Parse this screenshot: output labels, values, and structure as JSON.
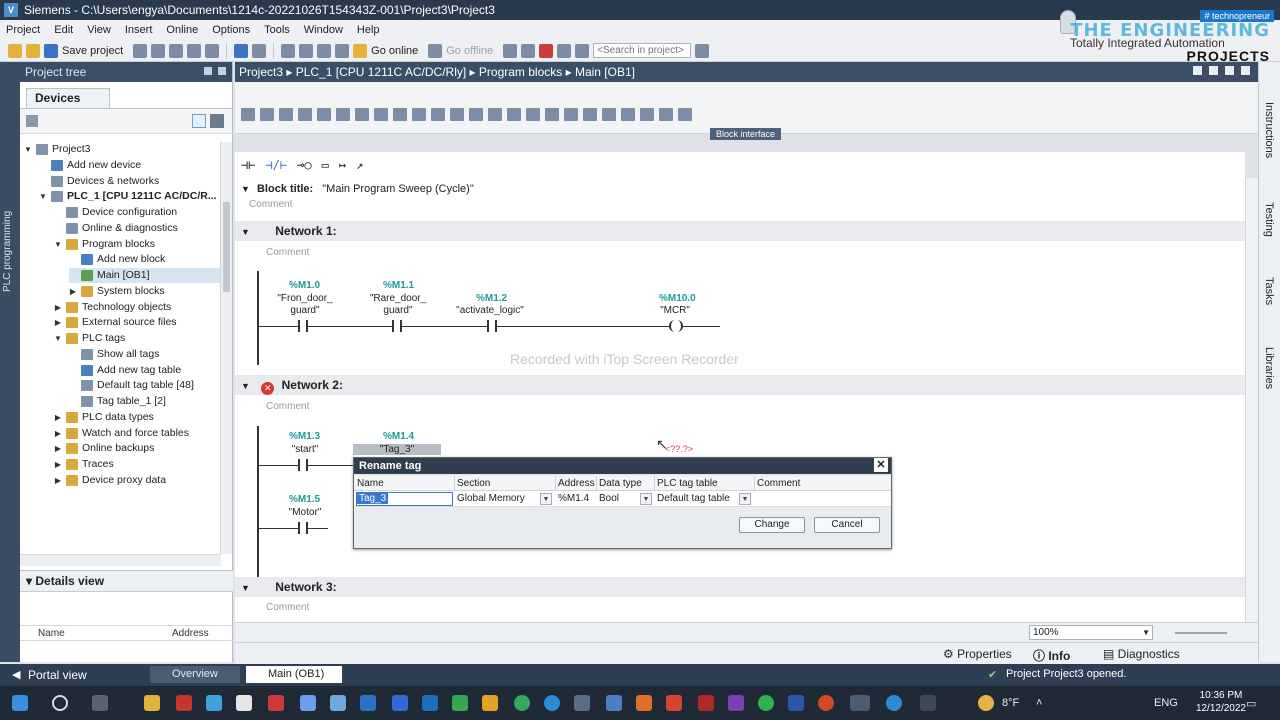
{
  "window": {
    "title": "Siemens  -  C:\\Users\\engya\\Documents\\1214c-20221026T154343Z-001\\Project3\\Project3"
  },
  "menu": [
    "Project",
    "Edit",
    "View",
    "Insert",
    "Online",
    "Options",
    "Tools",
    "Window",
    "Help"
  ],
  "toolbar": {
    "save_label": "Save project",
    "go_online": "Go online",
    "go_offline": "Go offline",
    "search_placeholder": "<Search in project>"
  },
  "brand": {
    "tag": "# technopreneur",
    "name": "THE ENGINEERING",
    "product": "Totally Integrated Automation",
    "projects": "PROJECTS"
  },
  "left_tab": "PLC programming",
  "project_tree": {
    "title": "Project tree",
    "devices_tab": "Devices",
    "items": [
      {
        "label": "Project3",
        "level": 0,
        "arrow": "down",
        "icon": "project-icon"
      },
      {
        "label": "Add new device",
        "level": 1,
        "arrow": "",
        "icon": "add-device-icon"
      },
      {
        "label": "Devices & networks",
        "level": 1,
        "arrow": "",
        "icon": "network-icon"
      },
      {
        "label": "PLC_1 [CPU 1211C AC/DC/R...",
        "level": 1,
        "arrow": "down",
        "icon": "plc-icon",
        "bold": true
      },
      {
        "label": "Device configuration",
        "level": 2,
        "arrow": "",
        "icon": "device-config-icon"
      },
      {
        "label": "Online & diagnostics",
        "level": 2,
        "arrow": "",
        "icon": "diagnostics-icon"
      },
      {
        "label": "Program blocks",
        "level": 2,
        "arrow": "down",
        "icon": "folder-icon"
      },
      {
        "label": "Add new block",
        "level": 3,
        "arrow": "",
        "icon": "add-block-icon"
      },
      {
        "label": "Main [OB1]",
        "level": 3,
        "arrow": "",
        "icon": "ob-icon",
        "selected": true
      },
      {
        "label": "System blocks",
        "level": 3,
        "arrow": "right",
        "icon": "folder-icon"
      },
      {
        "label": "Technology objects",
        "level": 2,
        "arrow": "right",
        "icon": "folder-icon"
      },
      {
        "label": "External source files",
        "level": 2,
        "arrow": "right",
        "icon": "folder-icon"
      },
      {
        "label": "PLC tags",
        "level": 2,
        "arrow": "down",
        "icon": "folder-icon"
      },
      {
        "label": "Show all tags",
        "level": 3,
        "arrow": "",
        "icon": "tags-icon"
      },
      {
        "label": "Add new tag table",
        "level": 3,
        "arrow": "",
        "icon": "add-table-icon"
      },
      {
        "label": "Default tag table [48]",
        "level": 3,
        "arrow": "",
        "icon": "tag-table-icon"
      },
      {
        "label": "Tag table_1 [2]",
        "level": 3,
        "arrow": "",
        "icon": "tag-table-icon"
      },
      {
        "label": "PLC data types",
        "level": 2,
        "arrow": "right",
        "icon": "folder-icon"
      },
      {
        "label": "Watch and force tables",
        "level": 2,
        "arrow": "right",
        "icon": "folder-icon"
      },
      {
        "label": "Online backups",
        "level": 2,
        "arrow": "right",
        "icon": "folder-icon"
      },
      {
        "label": "Traces",
        "level": 2,
        "arrow": "right",
        "icon": "folder-icon"
      },
      {
        "label": "Device proxy data",
        "level": 2,
        "arrow": "right",
        "icon": "folder-icon"
      }
    ]
  },
  "details_view": {
    "title": "Details view",
    "col_name": "Name",
    "col_address": "Address"
  },
  "editor": {
    "breadcrumb": "Project3  ▸  PLC_1 [CPU 1211C AC/DC/Rly]  ▸  Program blocks  ▸  Main [OB1]",
    "block_interface": "Block interface",
    "block_title_label": "Block title:",
    "block_title": "\"Main Program Sweep (Cycle)\"",
    "comment": "Comment",
    "watermark": "Recorded with iTop Screen Recorder",
    "networks": [
      {
        "title": "Network 1:"
      },
      {
        "title": "Network 2:"
      },
      {
        "title": "Network 3:"
      }
    ],
    "net1": {
      "c1_addr": "%M1.0",
      "c1_name": "\"Fron_door_",
      "c1_name2": "guard\"",
      "c2_addr": "%M1.1",
      "c2_name": "\"Rare_door_",
      "c2_name2": "guard\"",
      "c3_addr": "%M1.2",
      "c3_name": "\"activate_logic\"",
      "coil_addr": "%M10.0",
      "coil_name": "\"MCR\""
    },
    "net2": {
      "c1_addr": "%M1.3",
      "c1_name": "\"start\"",
      "c2_addr": "%M1.4",
      "c2_name": "\"Tag_3\"",
      "c3_addr": "%M1.5",
      "c3_name": "\"Motor\"",
      "unknown": "<??.?>"
    }
  },
  "dialog": {
    "title": "Rename tag",
    "headers": [
      "Name",
      "Section",
      "Address",
      "Data type",
      "PLC tag table",
      "Comment"
    ],
    "name": "Tag_3",
    "section": "Global Memory",
    "address": "%M1.4",
    "data_type": "Bool",
    "tag_table": "Default tag table",
    "change_label": "Change",
    "cancel_label": "Cancel"
  },
  "right_tabs": [
    "Instructions",
    "Testing",
    "Tasks",
    "Libraries"
  ],
  "zoom": "100%",
  "inspector_tabs": {
    "properties": "Properties",
    "info": "Info",
    "diagnostics": "Diagnostics"
  },
  "portal": {
    "portal_view": "Portal view",
    "overview": "Overview",
    "main_tab": "Main (OB1)",
    "status": "Project Project3 opened."
  },
  "taskbar": {
    "weather": "8°F",
    "lang": "ENG",
    "time": "10:36 PM",
    "date": "12/12/2022"
  }
}
